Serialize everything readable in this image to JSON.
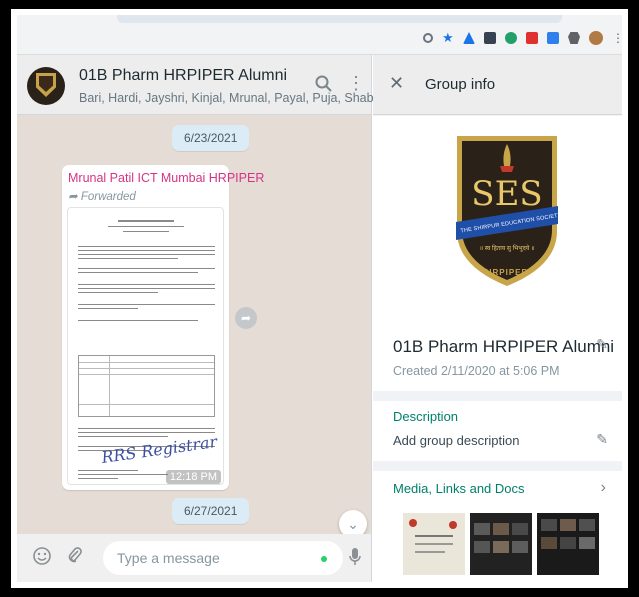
{
  "browser": {
    "toolbar_icons": [
      "zoom-icon",
      "star-icon",
      "extension-icon-1",
      "extension-icon-2",
      "extension-icon-3",
      "extension-icon-4",
      "extension-icon-5",
      "puzzle-icon",
      "profile-avatar",
      "menu-icon"
    ]
  },
  "chat": {
    "header": {
      "title": "01B Pharm HRPIPER Alumni",
      "participants": "Bari, Hardi, Jayshri, Kinjal, Mrunal, Payal, Puja, Shabana..."
    },
    "date_1": "6/23/2021",
    "message": {
      "sender": "Mrunal Patil ICT Mumbai HRPIPER",
      "forwarded": "Forwarded",
      "time": "12:18 PM"
    },
    "date_2": "6/27/2021",
    "composer": {
      "placeholder": "Type a message"
    }
  },
  "group_info": {
    "header_title": "Group info",
    "logo": {
      "initials": "SES",
      "ribbon": "THE SHIRPUR EDUCATION SOCIETY",
      "motto": "॥ स्व हिताय सु भिभुदये ॥",
      "bottom": "HRPIPER"
    },
    "name": "01B Pharm HRPIPER Alumni",
    "created": "Created 2/11/2020 at 5:06 PM",
    "description_label": "Description",
    "description_value": "Add group description",
    "media_label": "Media, Links and Docs"
  },
  "colors": {
    "accent": "#008069",
    "sender": "#d63384",
    "chat_bg": "#e5ddd5",
    "date_pill": "#dcecf6"
  }
}
